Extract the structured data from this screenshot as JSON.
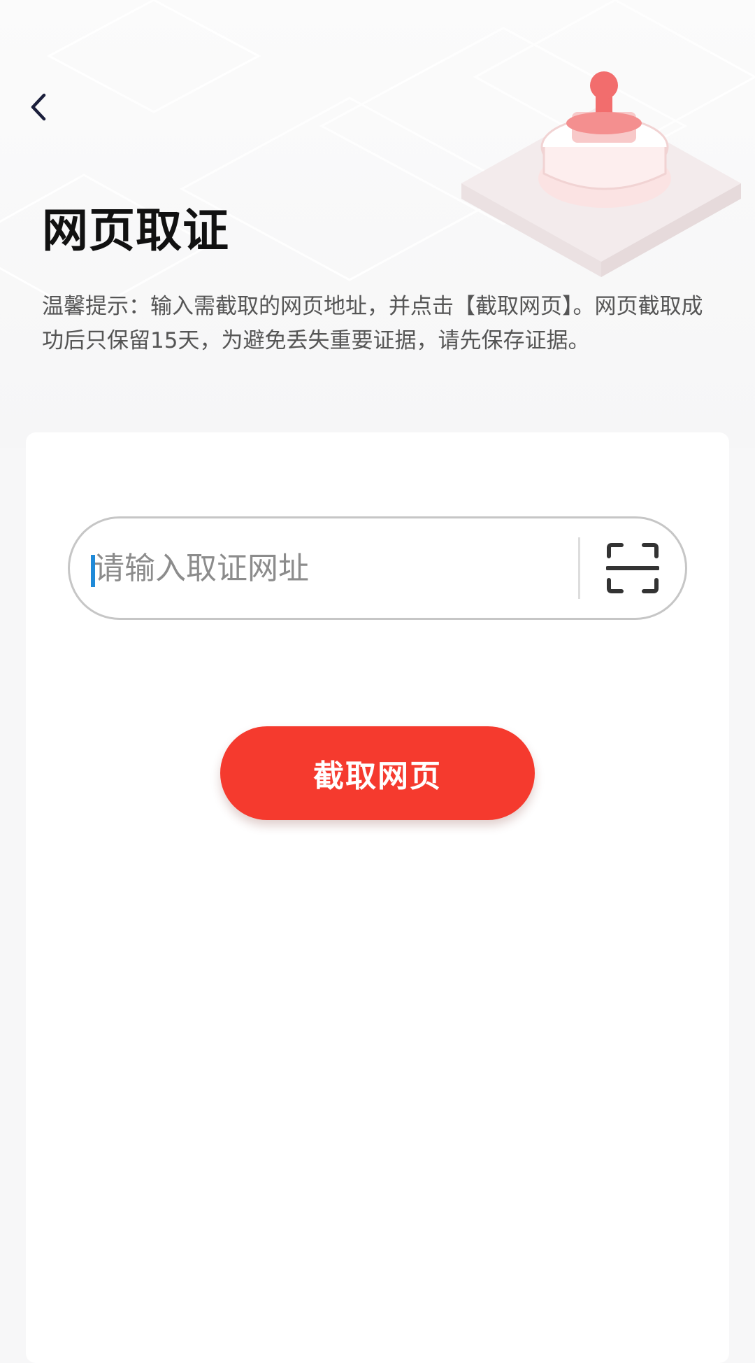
{
  "header": {
    "back_icon": "chevron-left-icon",
    "title": "网页取证",
    "tip": "温馨提示：输入需截取的网页地址，并点击【截取网页】。网页截取成功后只保留15天，为避免丢失重要证据，请先保存证据。",
    "illustration_icon": "stamp-icon"
  },
  "form": {
    "url_value": "",
    "url_placeholder": "请输入取证网址",
    "scan_icon": "scan-icon",
    "submit_label": "截取网页"
  },
  "colors": {
    "accent": "#f53a2e",
    "title": "#111111",
    "tip": "#555555",
    "placeholder": "#8c8c8c",
    "caret": "#1f8ad8",
    "background": "#f7f7f8",
    "card": "#ffffff"
  }
}
